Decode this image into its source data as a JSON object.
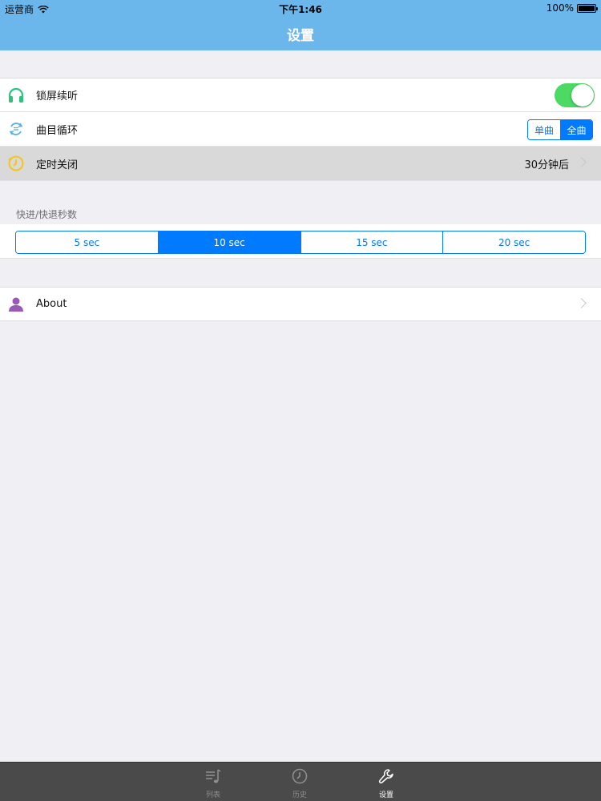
{
  "status_bar": {
    "carrier": "运营商",
    "time": "下午1:46",
    "battery": "100%"
  },
  "nav": {
    "title": "设置"
  },
  "rows": {
    "lock_screen": {
      "label": "锁屏续听",
      "icon": "headphones-icon",
      "toggle_on": true
    },
    "loop": {
      "label": "曲目循环",
      "icon": "repeat-icon",
      "options": [
        "单曲",
        "全曲"
      ],
      "selected": "全曲"
    },
    "timer": {
      "label": "定时关闭",
      "icon": "timer-icon",
      "value": "30分钟后"
    }
  },
  "seek": {
    "header": "快进/快退秒数",
    "options": [
      "5 sec",
      "10 sec",
      "15 sec",
      "20 sec"
    ],
    "selected": "10 sec"
  },
  "about": {
    "label": "About",
    "icon": "person-icon"
  },
  "tabbar": {
    "tabs": [
      {
        "label": "列表",
        "icon": "playlist-icon",
        "active": false
      },
      {
        "label": "历史",
        "icon": "clock-icon",
        "active": false
      },
      {
        "label": "设置",
        "icon": "wrench-icon",
        "active": true
      }
    ]
  },
  "colors": {
    "nav_bar": "#6bb6ea",
    "accent": "#007aff",
    "toggle_on": "#4cd964",
    "background": "#efeff4",
    "tabbar": "#4a4a4a"
  }
}
